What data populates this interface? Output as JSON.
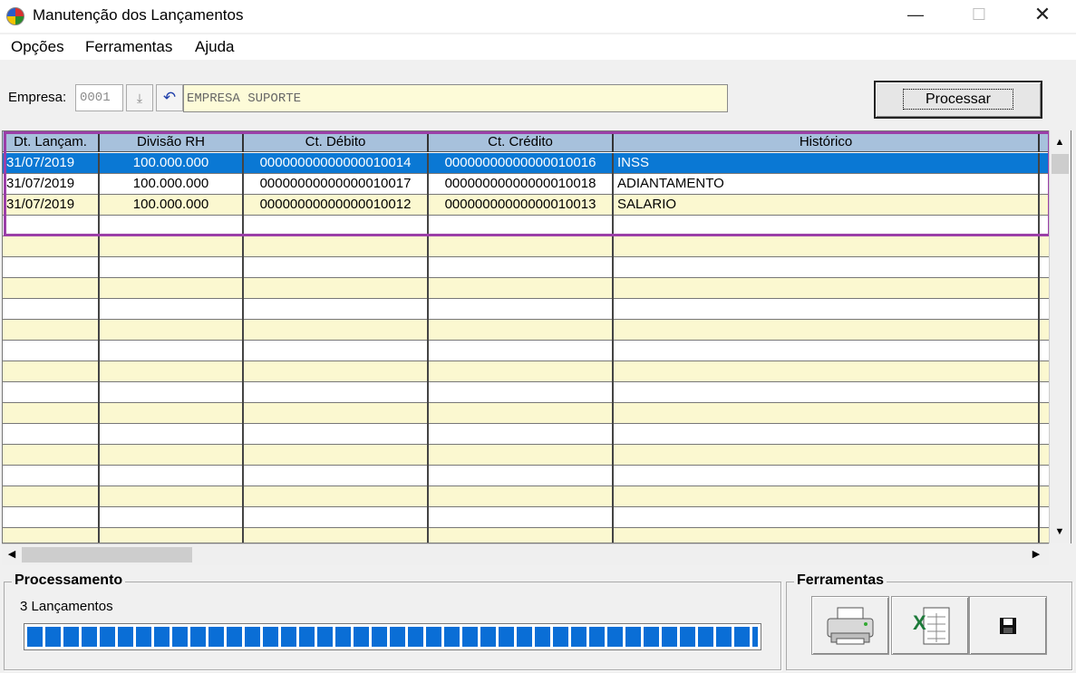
{
  "window": {
    "title": "Manutenção dos Lançamentos",
    "min": "—",
    "max": "☐",
    "close": "✕"
  },
  "menu": {
    "items": [
      "Opções",
      "Ferramentas",
      "Ajuda"
    ]
  },
  "toolbar": {
    "empresa_label": "Empresa:",
    "empresa_code": "0001",
    "empresa_name": "EMPRESA SUPORTE",
    "process_label": "Processar"
  },
  "grid": {
    "columns": [
      "Dt. Lançam.",
      "Divisão RH",
      "Ct. Débito",
      "Ct. Crédito",
      "Histórico"
    ],
    "rows": [
      [
        "31/07/2019",
        "100.000.000",
        "00000000000000010014",
        "00000000000000010016",
        "INSS"
      ],
      [
        "31/07/2019",
        "100.000.000",
        "00000000000000010017",
        "00000000000000010018",
        "ADIANTAMENTO"
      ],
      [
        "31/07/2019",
        "100.000.000",
        "00000000000000010012",
        "00000000000000010013",
        "SALARIO"
      ]
    ],
    "selected_row": 0
  },
  "processamento": {
    "title": "Processamento",
    "count_text": "3 Lançamentos",
    "progress": 1.0
  },
  "ferramentas": {
    "title": "Ferramentas",
    "buttons": [
      "printer-icon",
      "excel-icon",
      "save-icon"
    ]
  },
  "colors": {
    "selection": "#0a78d4",
    "row_alt": "#fbf8d0",
    "header": "#a7c1dc",
    "highlight": "#9b3fa8"
  }
}
